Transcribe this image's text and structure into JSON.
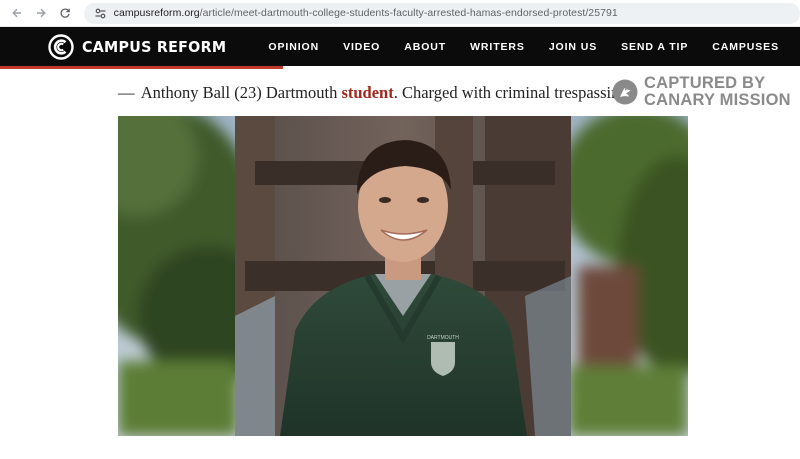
{
  "browser": {
    "url_host": "campusreform.org",
    "url_path": "/article/meet-dartmouth-college-students-faculty-arrested-hamas-endorsed-protest/25791",
    "icons": [
      "back-arrow-icon",
      "forward-arrow-icon",
      "reload-icon",
      "site-info-icon"
    ]
  },
  "site": {
    "logo_text": "CAMPUS REFORM",
    "nav": [
      "OPINION",
      "VIDEO",
      "ABOUT",
      "WRITERS",
      "JOIN US",
      "SEND A TIP",
      "CAMPUSES"
    ],
    "colors": {
      "header_bg": "#0b0b0b",
      "accent_red": "#c0392b",
      "keyword_red": "#a1271c"
    }
  },
  "article": {
    "caption_dash": "—",
    "caption_before": "Anthony Ball (23) Dartmouth",
    "caption_keyword": "student",
    "caption_after": ". Charged with criminal trespassing."
  },
  "watermark": {
    "line1": "CAPTURED BY",
    "line2": "CANARY MISSION",
    "icon": "canary-bird-icon"
  },
  "photo": {
    "sweater_badge_text": "DARTMOUTH"
  }
}
